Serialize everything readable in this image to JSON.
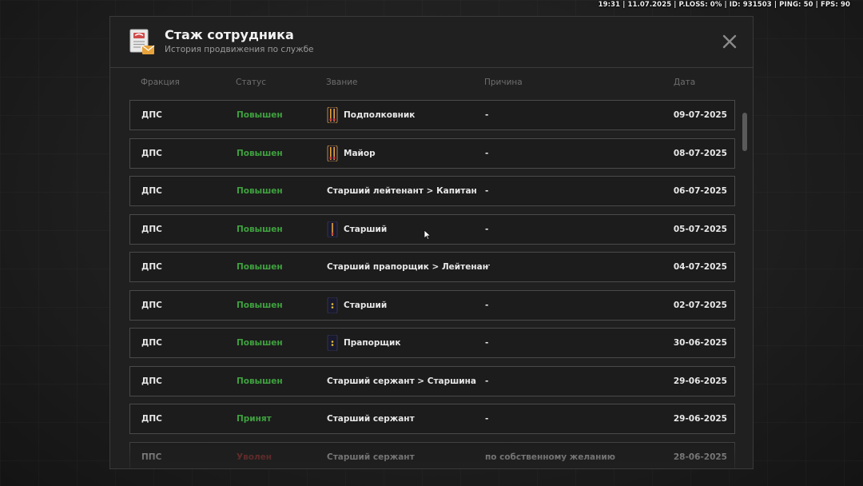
{
  "hud": {
    "text": "19:31 | 11.07.2025 | P.LOSS: 0% | ID: 931503 | PING: 50 | FPS: 90"
  },
  "header": {
    "title": "Стаж сотрудника",
    "subtitle": "История продвижения по службе",
    "icon": "document-envelope-icon",
    "close_icon": "close-icon"
  },
  "columns": {
    "fraction": "Фракция",
    "status": "Статус",
    "rank": "Звание",
    "reason": "Причина",
    "date": "Дата"
  },
  "colors": {
    "promoted": "#3fa13f",
    "fired": "#b83a3a",
    "accent_icon": "#e8a33a"
  },
  "rows": [
    {
      "fraction": "ДПС",
      "status": "Повышен",
      "status_type": "promoted",
      "rank": "Подполковник",
      "rank_icon": "epaulette-two-stripes-icon",
      "reason": "-",
      "date": "09-07-2025"
    },
    {
      "fraction": "ДПС",
      "status": "Повышен",
      "status_type": "promoted",
      "rank": "Майор",
      "rank_icon": "epaulette-two-stripes-icon",
      "reason": "-",
      "date": "08-07-2025"
    },
    {
      "fraction": "ДПС",
      "status": "Повышен",
      "status_type": "promoted",
      "rank": "Старший лейтенант > Капитан",
      "rank_icon": "",
      "reason": "-",
      "date": "06-07-2025"
    },
    {
      "fraction": "ДПС",
      "status": "Повышен",
      "status_type": "promoted",
      "rank": "Старший",
      "rank_icon": "epaulette-one-stripe-icon",
      "reason": "-",
      "date": "05-07-2025"
    },
    {
      "fraction": "ДПС",
      "status": "Повышен",
      "status_type": "promoted",
      "rank": "Старший прапорщик > Лейтенант",
      "rank_icon": "",
      "reason": "-",
      "date": "04-07-2025"
    },
    {
      "fraction": "ДПС",
      "status": "Повышен",
      "status_type": "promoted",
      "rank": "Старший",
      "rank_icon": "epaulette-stars-icon",
      "reason": "-",
      "date": "02-07-2025"
    },
    {
      "fraction": "ДПС",
      "status": "Повышен",
      "status_type": "promoted",
      "rank": "Прапорщик",
      "rank_icon": "epaulette-stars-icon",
      "reason": "-",
      "date": "30-06-2025"
    },
    {
      "fraction": "ДПС",
      "status": "Повышен",
      "status_type": "promoted",
      "rank": "Старший сержант > Старшина",
      "rank_icon": "",
      "reason": "-",
      "date": "29-06-2025"
    },
    {
      "fraction": "ДПС",
      "status": "Принят",
      "status_type": "hired",
      "rank": "Старший сержант",
      "rank_icon": "",
      "reason": "-",
      "date": "29-06-2025"
    },
    {
      "fraction": "ППС",
      "status": "Уволен",
      "status_type": "fired",
      "rank": "Старший сержант",
      "rank_icon": "",
      "reason": "по собственному желанию",
      "date": "28-06-2025"
    }
  ]
}
